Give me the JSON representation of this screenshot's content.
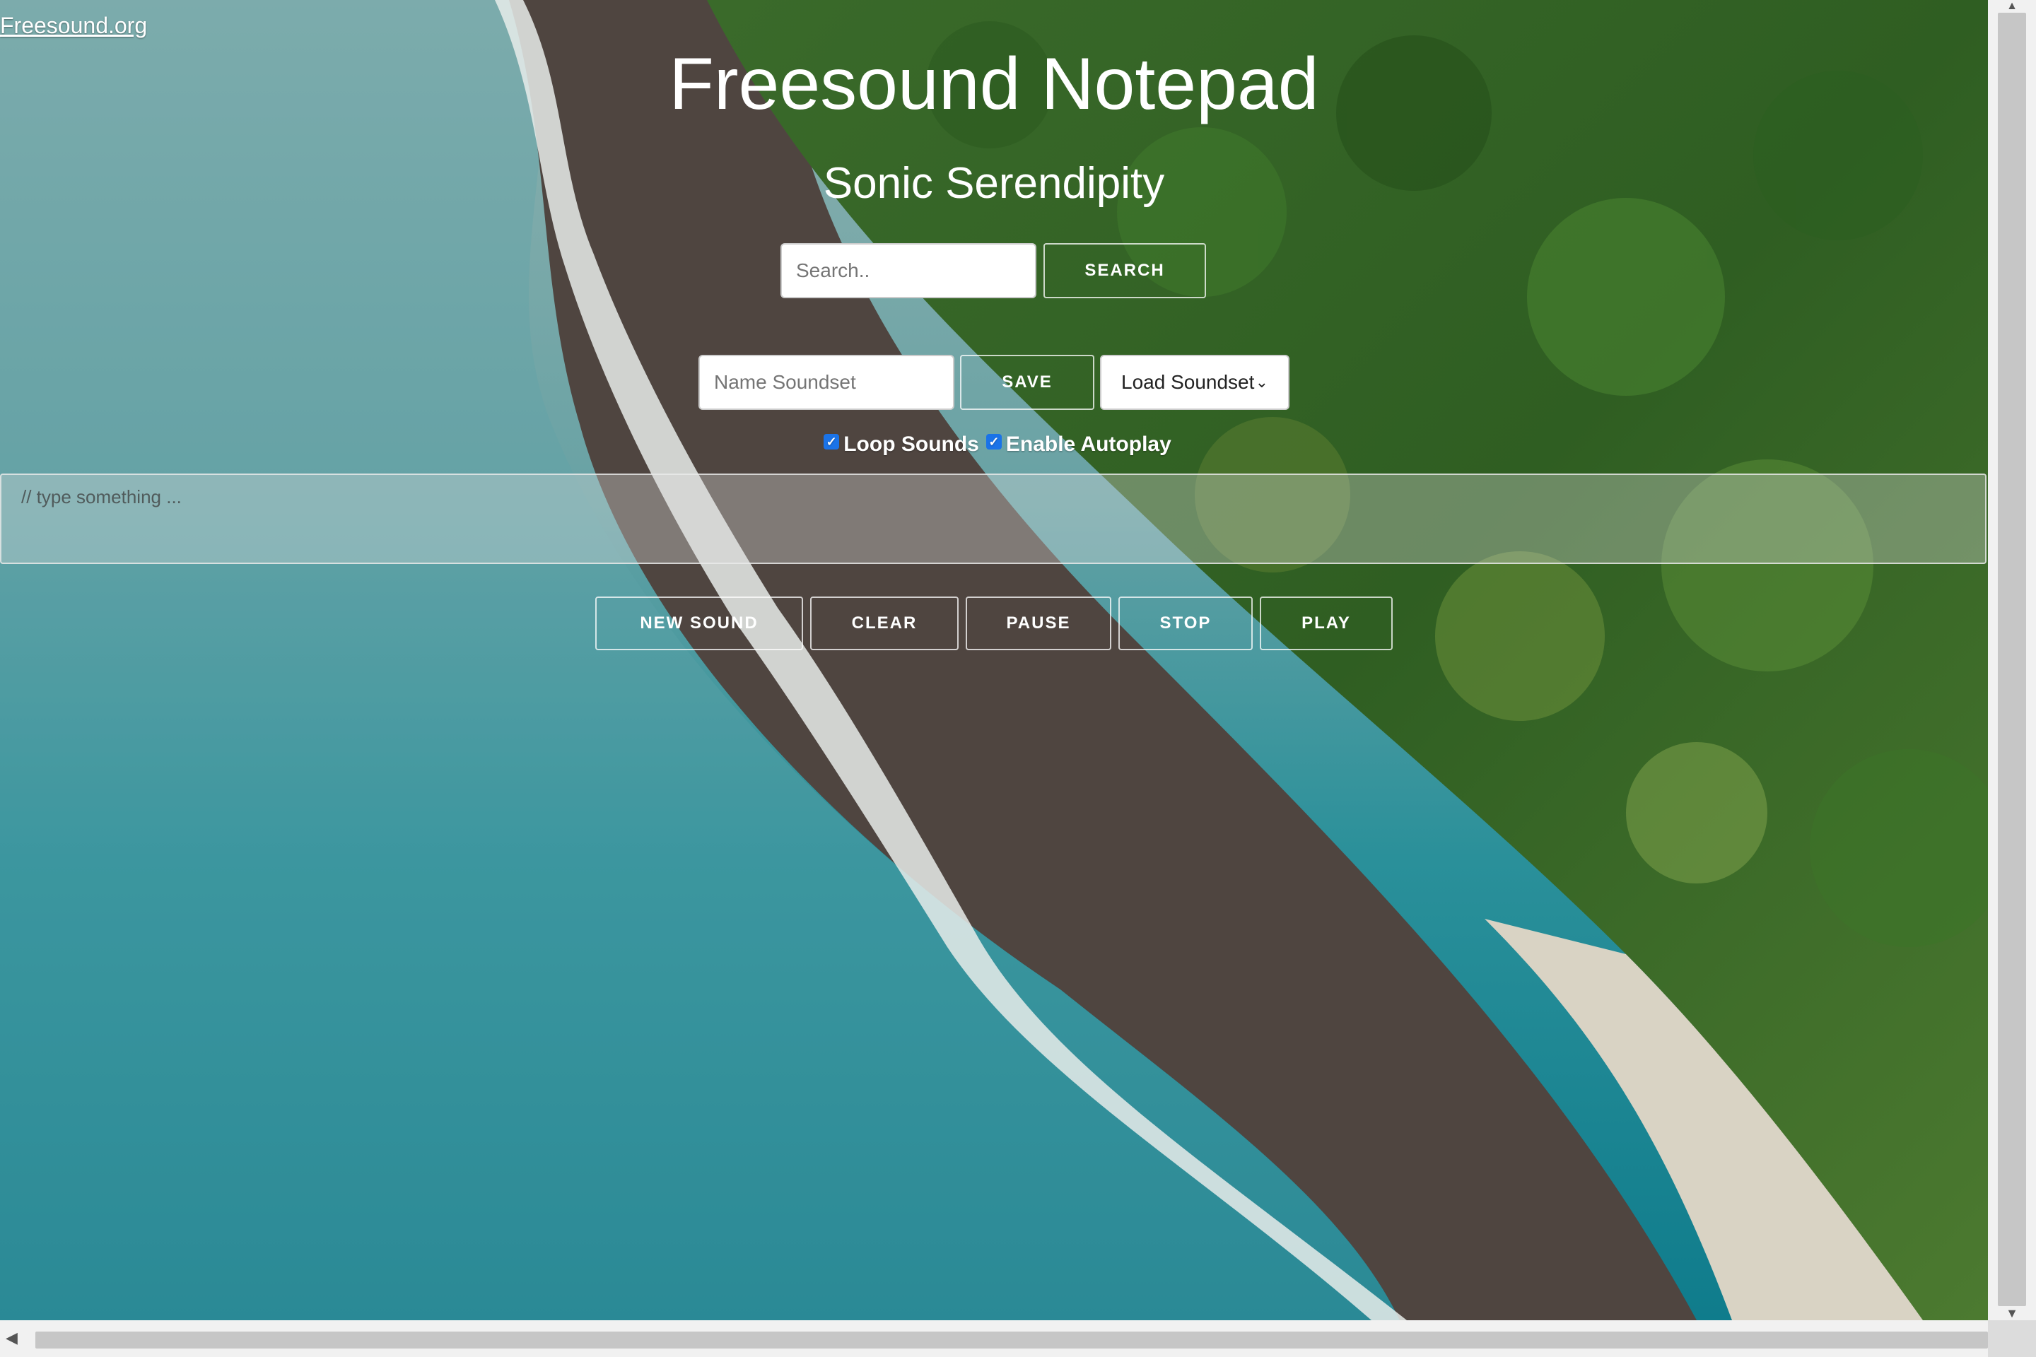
{
  "header": {
    "site_link": "Freesound.org",
    "title": "Freesound Notepad",
    "subtitle": "Sonic Serendipity"
  },
  "search": {
    "placeholder": "Search..",
    "button_label": "SEARCH"
  },
  "soundset": {
    "name_placeholder": "Name Soundset",
    "save_label": "SAVE",
    "load_selected": "Load Soundset"
  },
  "options": {
    "loop_label": "Loop Sounds",
    "loop_checked": true,
    "autoplay_label": "Enable Autoplay",
    "autoplay_checked": true
  },
  "notepad": {
    "placeholder": "// type something ..."
  },
  "controls": {
    "new_sound": "NEW SOUND",
    "clear": "CLEAR",
    "pause": "PAUSE",
    "stop": "STOP",
    "play": "PLAY"
  },
  "colors": {
    "checkbox_accent": "#1a73e8",
    "text": "#ffffff"
  },
  "icons": {
    "checkbox": "check-icon",
    "select": "chevron-down-icon"
  }
}
